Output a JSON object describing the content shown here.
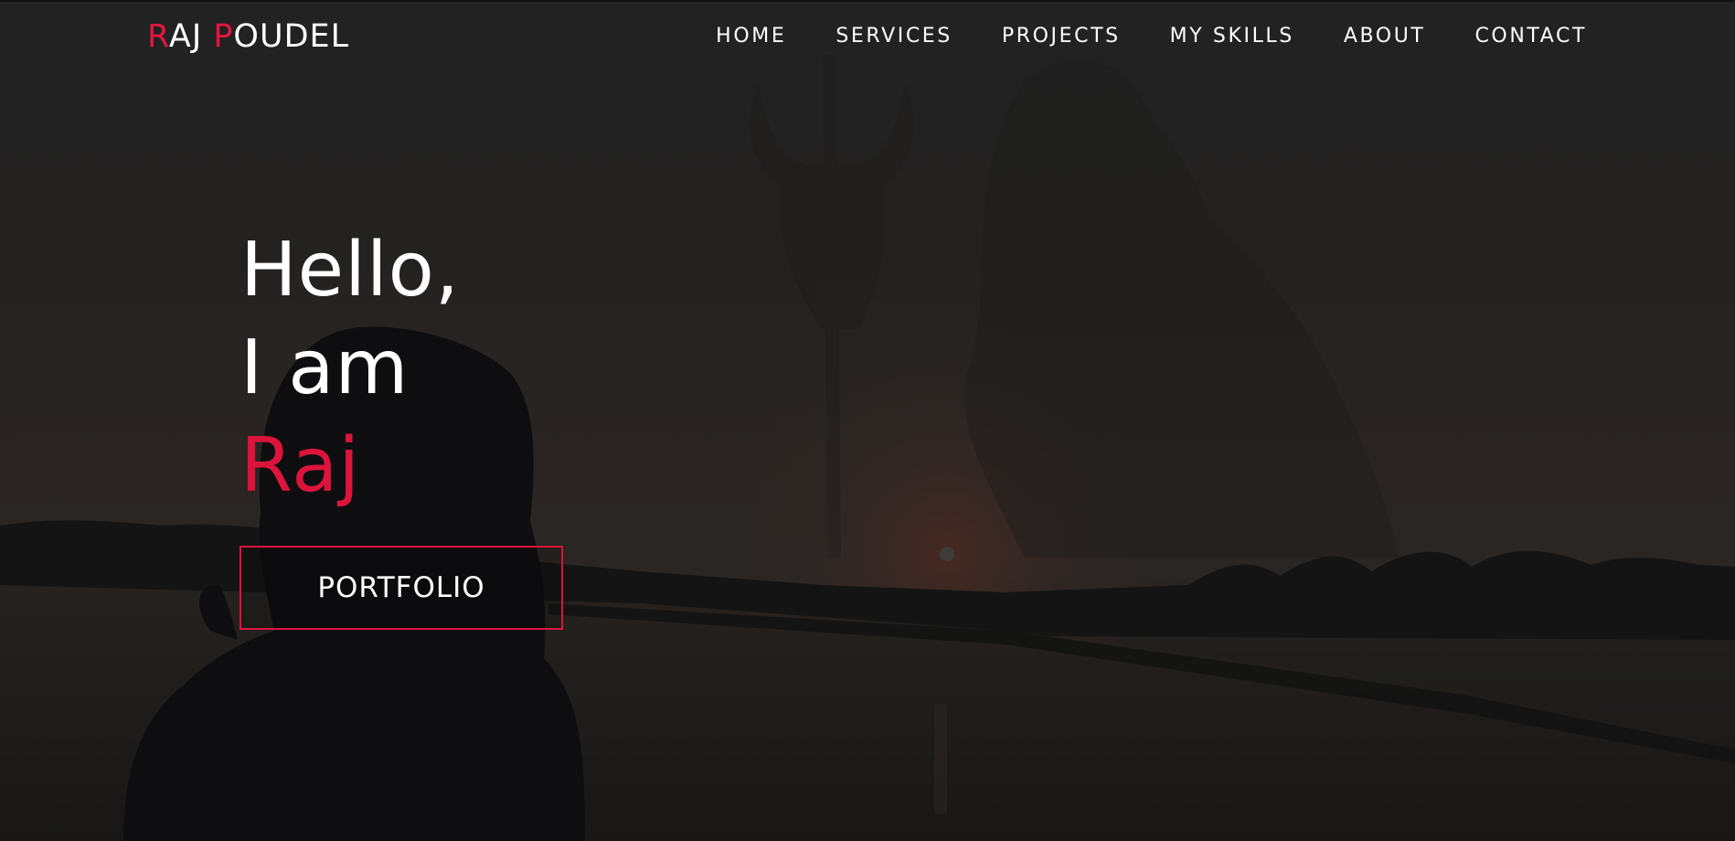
{
  "header": {
    "brand": {
      "first_initial": "R",
      "first_rest": "AJ",
      "last_initial": "P",
      "last_rest": "OUDEL"
    },
    "nav": [
      {
        "label": "HOME"
      },
      {
        "label": "SERVICES"
      },
      {
        "label": "PROJECTS"
      },
      {
        "label": "MY SKILLS"
      },
      {
        "label": "ABOUT"
      },
      {
        "label": "CONTACT"
      }
    ]
  },
  "hero": {
    "line1": "Hello,",
    "line2": "I am",
    "name": "Raj",
    "cta_label": "PORTFOLIO"
  },
  "colors": {
    "accent": "#dc143c",
    "text": "#ffffff",
    "background": "#242221"
  }
}
